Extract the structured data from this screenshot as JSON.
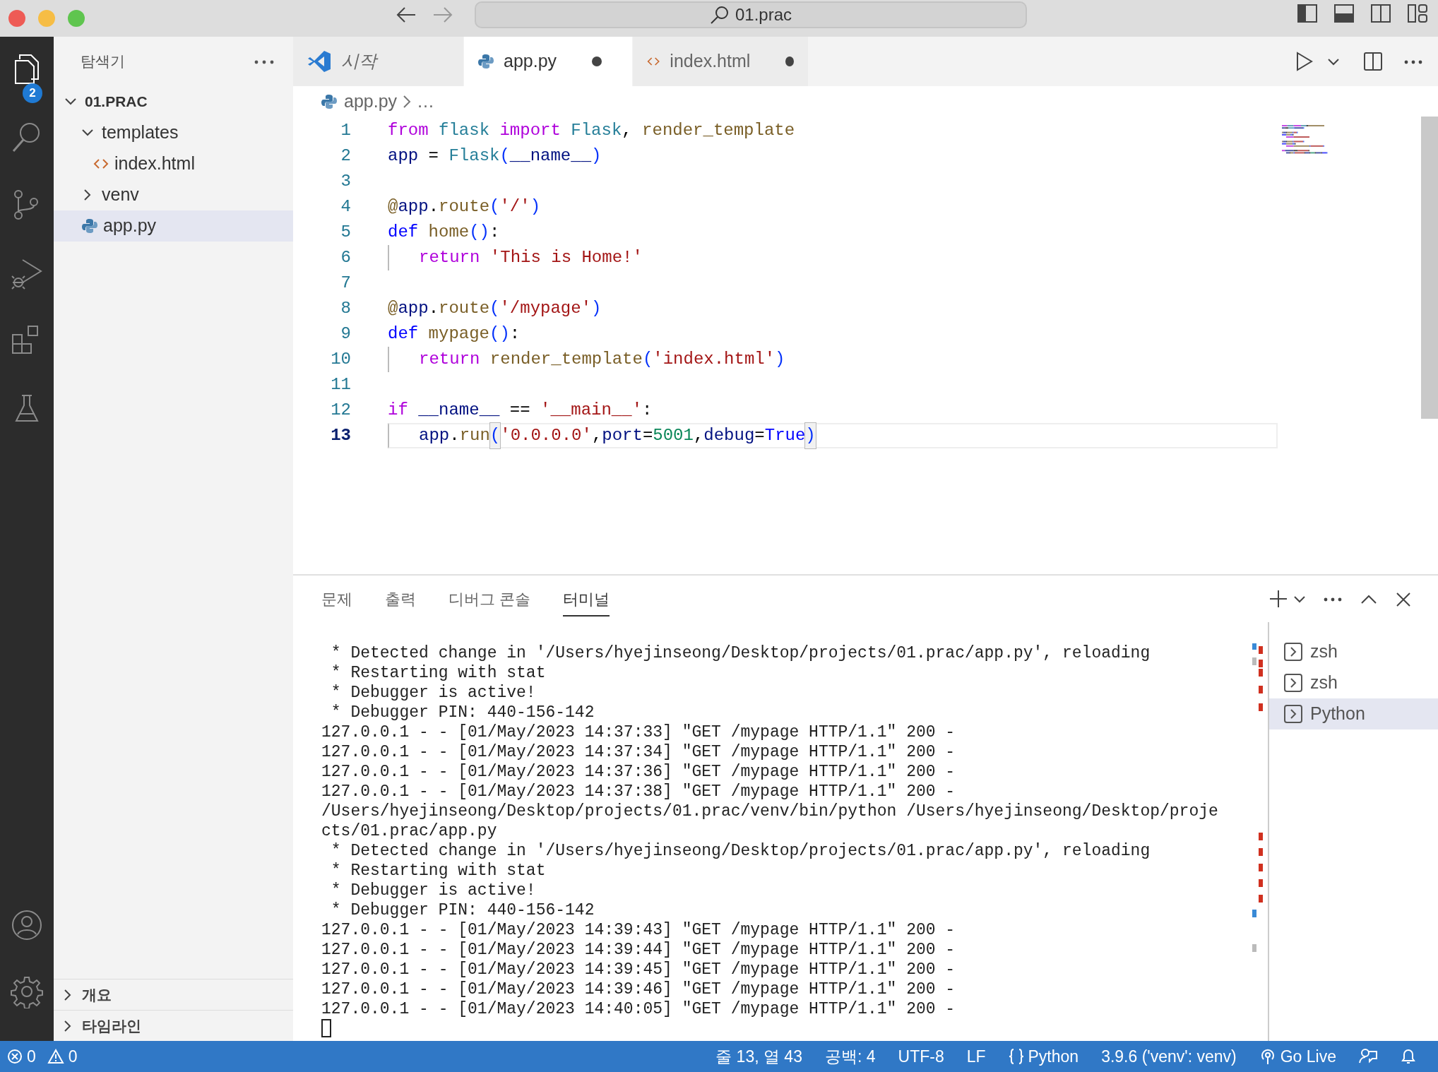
{
  "title_bar": {
    "search": "01.prac"
  },
  "activity_bar": {
    "items": [
      {
        "kind": "files",
        "selected": true,
        "badge": "2"
      },
      {
        "kind": "search",
        "selected": false
      },
      {
        "kind": "branch",
        "selected": false
      },
      {
        "kind": "run",
        "selected": false
      },
      {
        "kind": "blocks",
        "selected": false
      },
      {
        "kind": "flask",
        "selected": false
      }
    ],
    "bottom": [
      {
        "kind": "account"
      },
      {
        "kind": "settings"
      }
    ]
  },
  "sidebar": {
    "title": "탐색기",
    "tree": [
      {
        "label": "01.PRAC",
        "kind": "root",
        "expanded": true,
        "selected": false,
        "children": [
          {
            "label": "templates",
            "kind": "folder",
            "expanded": true,
            "selected": false,
            "children": [
              {
                "label": "index.html",
                "kind": "html",
                "selected": false
              }
            ]
          },
          {
            "label": "venv",
            "kind": "folder",
            "expanded": false,
            "selected": false
          },
          {
            "label": "app.py",
            "kind": "python",
            "selected": true
          }
        ]
      }
    ],
    "sections": [
      {
        "label": "개요",
        "expanded": false
      },
      {
        "label": "타임라인",
        "expanded": false
      }
    ]
  },
  "editor": {
    "tabs": [
      {
        "label": "시작",
        "kind": "welcome",
        "selected": false,
        "dirty": false
      },
      {
        "label": "app.py",
        "kind": "python",
        "selected": true,
        "dirty": true
      },
      {
        "label": "index.html",
        "kind": "html",
        "selected": false,
        "dirty": true
      }
    ],
    "breadcrumb": [
      {
        "label": "app.py",
        "kind": "python"
      },
      {
        "label": "…",
        "kind": "more"
      }
    ],
    "lines": [
      {
        "number": "1",
        "current": false,
        "indent": false,
        "tokens": [
          {
            "text": "from ",
            "kind": "kw"
          },
          {
            "text": "flask ",
            "kind": "cls"
          },
          {
            "text": "import ",
            "kind": "kw"
          },
          {
            "text": "Flask",
            "kind": "cls"
          },
          {
            "text": ", ",
            "kind": "punct"
          },
          {
            "text": "render_template",
            "kind": "fn"
          }
        ]
      },
      {
        "number": "2",
        "current": false,
        "indent": false,
        "tokens": [
          {
            "text": "app",
            "kind": "var"
          },
          {
            "text": " = ",
            "kind": "punct"
          },
          {
            "text": "Flask",
            "kind": "cls"
          },
          {
            "text": "(",
            "kind": "paren"
          },
          {
            "text": "__name__",
            "kind": "var"
          },
          {
            "text": ")",
            "kind": "paren"
          }
        ]
      },
      {
        "number": "3",
        "current": false,
        "indent": false
      },
      {
        "number": "4",
        "current": false,
        "indent": false,
        "tokens": [
          {
            "text": "@",
            "kind": "fn"
          },
          {
            "text": "app",
            "kind": "var"
          },
          {
            "text": ".",
            "kind": "punct"
          },
          {
            "text": "route",
            "kind": "fn"
          },
          {
            "text": "(",
            "kind": "paren"
          },
          {
            "text": "'/'",
            "kind": "str"
          },
          {
            "text": ")",
            "kind": "paren"
          }
        ]
      },
      {
        "number": "5",
        "current": false,
        "indent": false,
        "tokens": [
          {
            "text": "def ",
            "kind": "ctl"
          },
          {
            "text": "home",
            "kind": "fn"
          },
          {
            "text": "()",
            "kind": "paren"
          },
          {
            "text": ":",
            "kind": "punct"
          }
        ]
      },
      {
        "number": "6",
        "current": false,
        "indent": true,
        "tokens": [
          {
            "text": "return ",
            "kind": "kw"
          },
          {
            "text": "'This is Home!'",
            "kind": "str"
          }
        ]
      },
      {
        "number": "7",
        "current": false,
        "indent": false
      },
      {
        "number": "8",
        "current": false,
        "indent": false,
        "tokens": [
          {
            "text": "@",
            "kind": "fn"
          },
          {
            "text": "app",
            "kind": "var"
          },
          {
            "text": ".",
            "kind": "punct"
          },
          {
            "text": "route",
            "kind": "fn"
          },
          {
            "text": "(",
            "kind": "paren"
          },
          {
            "text": "'/mypage'",
            "kind": "str"
          },
          {
            "text": ")",
            "kind": "paren"
          }
        ]
      },
      {
        "number": "9",
        "current": false,
        "indent": false,
        "tokens": [
          {
            "text": "def ",
            "kind": "ctl"
          },
          {
            "text": "mypage",
            "kind": "fn"
          },
          {
            "text": "()",
            "kind": "paren"
          },
          {
            "text": ":",
            "kind": "punct"
          }
        ]
      },
      {
        "number": "10",
        "current": false,
        "indent": true,
        "tokens": [
          {
            "text": "return ",
            "kind": "kw"
          },
          {
            "text": "render_template",
            "kind": "fn"
          },
          {
            "text": "(",
            "kind": "paren"
          },
          {
            "text": "'index.html'",
            "kind": "str"
          },
          {
            "text": ")",
            "kind": "paren"
          }
        ]
      },
      {
        "number": "11",
        "current": false,
        "indent": false
      },
      {
        "number": "12",
        "current": false,
        "indent": false,
        "tokens": [
          {
            "text": "if ",
            "kind": "kw"
          },
          {
            "text": "__name__",
            "kind": "var"
          },
          {
            "text": " == ",
            "kind": "punct"
          },
          {
            "text": "'__main__'",
            "kind": "str"
          },
          {
            "text": ":",
            "kind": "punct"
          }
        ]
      },
      {
        "number": "13",
        "current": true,
        "indent": true,
        "tokens": [
          {
            "text": "app",
            "kind": "var"
          },
          {
            "text": ".",
            "kind": "punct"
          },
          {
            "text": "run",
            "kind": "fn"
          },
          {
            "text": "(",
            "kind": "paren",
            "match": true
          },
          {
            "text": "'0.0.0.0'",
            "kind": "str"
          },
          {
            "text": ",",
            "kind": "punct"
          },
          {
            "text": "port",
            "kind": "var"
          },
          {
            "text": "=",
            "kind": "punct"
          },
          {
            "text": "5001",
            "kind": "num"
          },
          {
            "text": ",",
            "kind": "punct"
          },
          {
            "text": "debug",
            "kind": "var"
          },
          {
            "text": "=",
            "kind": "punct"
          },
          {
            "text": "True",
            "kind": "ctl"
          },
          {
            "text": ")",
            "kind": "paren",
            "match": true
          }
        ]
      }
    ]
  },
  "panel": {
    "tabs": [
      {
        "label": "문제",
        "selected": false
      },
      {
        "label": "출력",
        "selected": false
      },
      {
        "label": "디버그 콘솔",
        "selected": false
      },
      {
        "label": "터미널",
        "selected": true
      }
    ],
    "terminal_lines": [
      " * Detected change in '/Users/hyejinseong/Desktop/projects/01.prac/app.py', reloading",
      " * Restarting with stat",
      " * Debugger is active!",
      " * Debugger PIN: 440-156-142",
      "127.0.0.1 - - [01/May/2023 14:37:33] \"GET /mypage HTTP/1.1\" 200 -",
      "127.0.0.1 - - [01/May/2023 14:37:34] \"GET /mypage HTTP/1.1\" 200 -",
      "127.0.0.1 - - [01/May/2023 14:37:36] \"GET /mypage HTTP/1.1\" 200 -",
      "127.0.0.1 - - [01/May/2023 14:37:38] \"GET /mypage HTTP/1.1\" 200 -",
      "/Users/hyejinseong/Desktop/projects/01.prac/venv/bin/python /Users/hyejinseong/Desktop/proje",
      "cts/01.prac/app.py",
      " * Detected change in '/Users/hyejinseong/Desktop/projects/01.prac/app.py', reloading",
      " * Restarting with stat",
      " * Debugger is active!",
      " * Debugger PIN: 440-156-142",
      "127.0.0.1 - - [01/May/2023 14:39:43] \"GET /mypage HTTP/1.1\" 200 -",
      "127.0.0.1 - - [01/May/2023 14:39:44] \"GET /mypage HTTP/1.1\" 200 -",
      "127.0.0.1 - - [01/May/2023 14:39:45] \"GET /mypage HTTP/1.1\" 200 -",
      "127.0.0.1 - - [01/May/2023 14:39:46] \"GET /mypage HTTP/1.1\" 200 -",
      "127.0.0.1 - - [01/May/2023 14:40:05] \"GET /mypage HTTP/1.1\" 200 -"
    ],
    "terminals": [
      {
        "label": "zsh",
        "selected": false
      },
      {
        "label": "zsh",
        "selected": false
      },
      {
        "label": "Python",
        "selected": true
      }
    ]
  },
  "status_bar": {
    "errors": "0",
    "warnings": "0",
    "items": [
      {
        "text": "줄 13, 열 43",
        "kind": "text"
      },
      {
        "text": "공백: 4",
        "kind": "text"
      },
      {
        "text": "UTF-8",
        "kind": "text"
      },
      {
        "text": "LF",
        "kind": "text"
      },
      {
        "kind": "language",
        "text": "Python"
      },
      {
        "text": "3.9.6 ('venv': venv)",
        "kind": "text"
      },
      {
        "kind": "live",
        "text": "Go Live"
      },
      {
        "kind": "feedback"
      },
      {
        "kind": "notifications"
      }
    ]
  }
}
